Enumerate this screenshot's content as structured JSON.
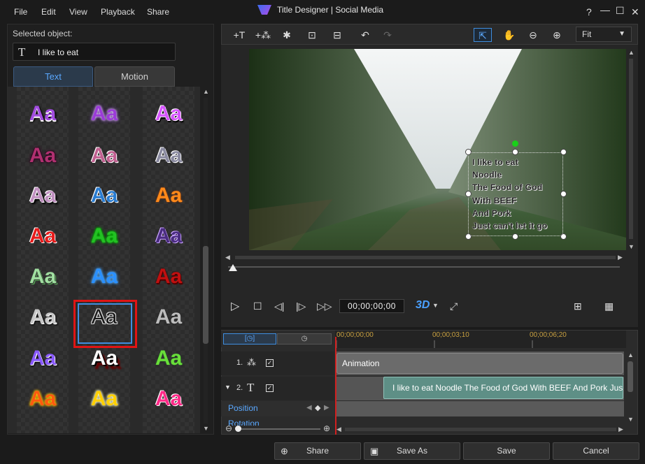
{
  "menu": {
    "file": "File",
    "edit": "Edit",
    "view": "View",
    "playback": "Playback",
    "share": "Share"
  },
  "window": {
    "title": "Title Designer | Social Media",
    "help": "?",
    "minimize": "—",
    "maximize": "☐",
    "close": "✕"
  },
  "left": {
    "selected_label": "Selected object:",
    "selected_icon": "T",
    "selected_value": "I like to eat",
    "tabs": {
      "text": "Text",
      "motion": "Motion"
    },
    "presets_glyph": "Aa"
  },
  "toolbar": {
    "fit": "Fit"
  },
  "video": {
    "title_lines": [
      "I like to eat",
      "Noodle",
      "The Food of God",
      "With BEEF",
      "And Pork",
      "Just can't let it go"
    ]
  },
  "transport": {
    "timecode": "00;00;00;00",
    "mode3d": "3D"
  },
  "timeline": {
    "ruler": [
      "00;00;00;00",
      "00;00;03;10",
      "00;00;06;20"
    ],
    "track1": {
      "num": "1.",
      "clip": "Animation"
    },
    "track2": {
      "num": "2.",
      "icon": "T",
      "clip": "I like to eat Noodle The Food of God With BEEF And Pork Just c"
    },
    "position": "Position",
    "rotation": "Rotation"
  },
  "buttons": {
    "share": "Share",
    "save_as": "Save As",
    "save": "Save",
    "cancel": "Cancel"
  },
  "colors": {
    "accent": "#3f8ee0",
    "selection": "#e01414",
    "playhead": "#d02020",
    "clip_title": "#5e8f86"
  }
}
